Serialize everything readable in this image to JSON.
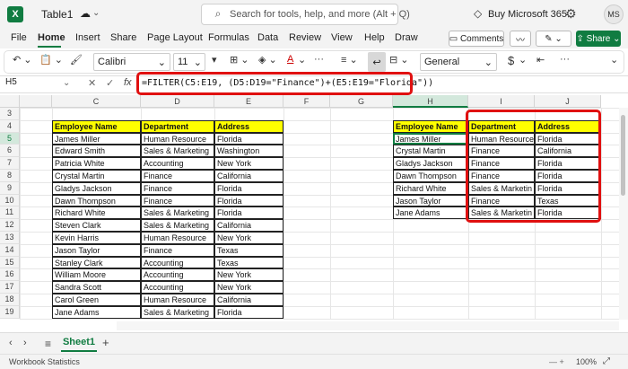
{
  "titlebar": {
    "app_letter": "X",
    "doc_title": "Table1",
    "search_text": "Search for tools, help, and more (Alt + Q)",
    "buy_text": "Buy Microsoft 365",
    "avatar_initials": "MS"
  },
  "menu": {
    "items": [
      "File",
      "Home",
      "Insert",
      "Share",
      "Page Layout",
      "Formulas",
      "Data",
      "Review",
      "View",
      "Help",
      "Draw"
    ],
    "comments_label": "Comments",
    "share_label": "Share"
  },
  "ribbon": {
    "font": "Calibri",
    "size": "11",
    "number_format": "General",
    "currency_symbol": "$"
  },
  "formula_bar": {
    "cell_ref": "H5",
    "fx": "fx",
    "formula": "=FILTER(C5:E19, (D5:D19=\"Finance\")+(E5:E19=\"Florida\"))"
  },
  "grid": {
    "columns": [
      "C",
      "D",
      "E",
      "F",
      "G",
      "H",
      "I",
      "J"
    ],
    "rows": [
      "3",
      "4",
      "5",
      "6",
      "7",
      "8",
      "9",
      "10",
      "11",
      "12",
      "13",
      "14",
      "15",
      "16",
      "17",
      "18",
      "19"
    ],
    "source_headers": [
      "Employee Name",
      "Department",
      "Address"
    ],
    "source_rows": [
      [
        "James Miller",
        "Human Resource",
        "Florida"
      ],
      [
        "Edward Smith",
        "Sales & Marketing",
        "Washington"
      ],
      [
        "Patricia White",
        "Accounting",
        "New York"
      ],
      [
        "Crystal Martin",
        "Finance",
        "California"
      ],
      [
        "Gladys Jackson",
        "Finance",
        "Florida"
      ],
      [
        "Dawn Thompson",
        "Finance",
        "Florida"
      ],
      [
        "Richard White",
        "Sales & Marketing",
        "Florida"
      ],
      [
        "Steven Clark",
        "Sales & Marketing",
        "California"
      ],
      [
        "Kevin Harris",
        "Human Resource",
        "New York"
      ],
      [
        "Jason Taylor",
        "Finance",
        "Texas"
      ],
      [
        "Stanley Clark",
        "Accounting",
        "Texas"
      ],
      [
        "William Moore",
        "Accounting",
        "New York"
      ],
      [
        "Sandra Scott",
        "Accounting",
        "New York"
      ],
      [
        "Carol Green",
        "Human Resource",
        "California"
      ],
      [
        "Jane Adams",
        "Sales & Marketing",
        "Florida"
      ]
    ],
    "result_headers": [
      "Employee Name",
      "Department",
      "Address"
    ],
    "result_rows": [
      [
        "James Miller",
        "Human Resource",
        "Florida"
      ],
      [
        "Crystal Martin",
        "Finance",
        "California"
      ],
      [
        "Gladys Jackson",
        "Finance",
        "Florida"
      ],
      [
        "Dawn Thompson",
        "Finance",
        "Florida"
      ],
      [
        "Richard White",
        "Sales & Marketin",
        "Florida"
      ],
      [
        "Jason Taylor",
        "Finance",
        "Texas"
      ],
      [
        "Jane Adams",
        "Sales & Marketin",
        "Florida"
      ]
    ]
  },
  "sheets": {
    "active": "Sheet1"
  },
  "status": {
    "left": "Workbook Statistics",
    "zoom": "100%"
  },
  "colors": {
    "accent": "#107c41",
    "highlight": "#e01010",
    "header_fill": "#ffff00"
  }
}
